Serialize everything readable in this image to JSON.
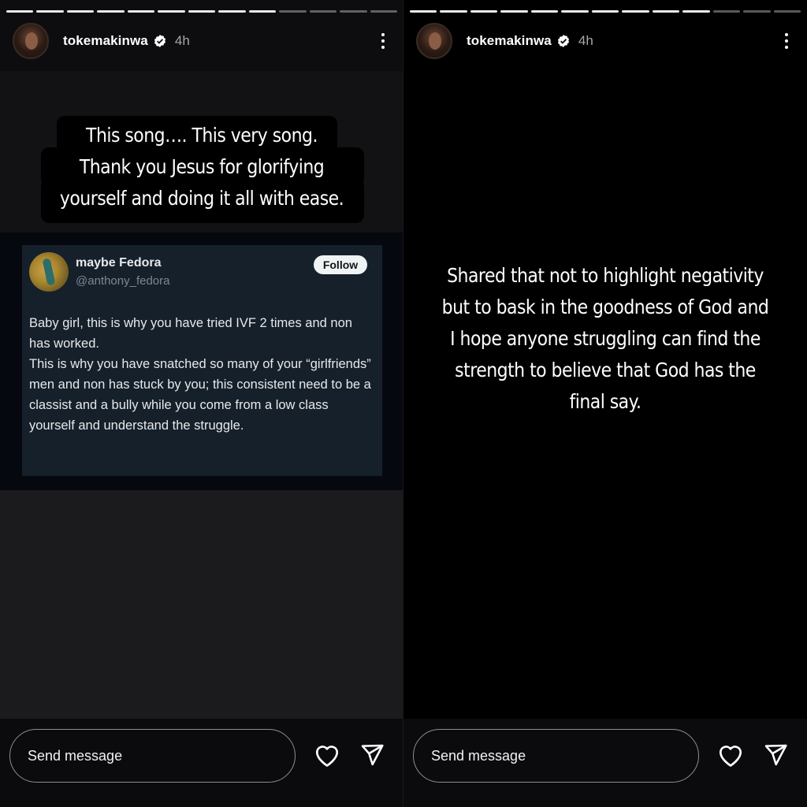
{
  "stories": [
    {
      "progress": {
        "total": 13,
        "viewed": 9
      },
      "header": {
        "username": "tokemakinwa",
        "time": "4h",
        "verified_icon": "verified-badge-icon",
        "more_icon": "more-vertical-icon"
      },
      "caption": [
        "This song…. This very song.",
        "Thank you Jesus for glorifying",
        "yourself and doing it all with ease."
      ],
      "tweet": {
        "name": "maybe Fedora",
        "handle": "@anthony_fedora",
        "follow_label": "Follow",
        "body": [
          "Baby girl, this is why you have tried IVF 2 times and non has worked.",
          "This is why you have snatched so many of your “girlfriends” men and non has stuck by you; this consistent need to be a classist and a bully while you come from a low class yourself and understand the struggle."
        ]
      },
      "composer": {
        "placeholder": "Send message",
        "like_icon": "heart-icon",
        "share_icon": "send-icon"
      }
    },
    {
      "progress": {
        "total": 13,
        "viewed": 10
      },
      "header": {
        "username": "tokemakinwa",
        "time": "4h",
        "verified_icon": "verified-badge-icon",
        "more_icon": "more-vertical-icon"
      },
      "text": [
        "Shared that not to highlight negativity",
        "but to bask in the goodness of God and",
        "I hope anyone struggling can find the",
        "strength to believe that God has the",
        "final say."
      ],
      "composer": {
        "placeholder": "Send message",
        "like_icon": "heart-icon",
        "share_icon": "send-icon"
      }
    }
  ],
  "colors": {
    "tweet_bg": "#15202b",
    "verified": "#ffffff",
    "progress_active": "#e9e9e9"
  }
}
